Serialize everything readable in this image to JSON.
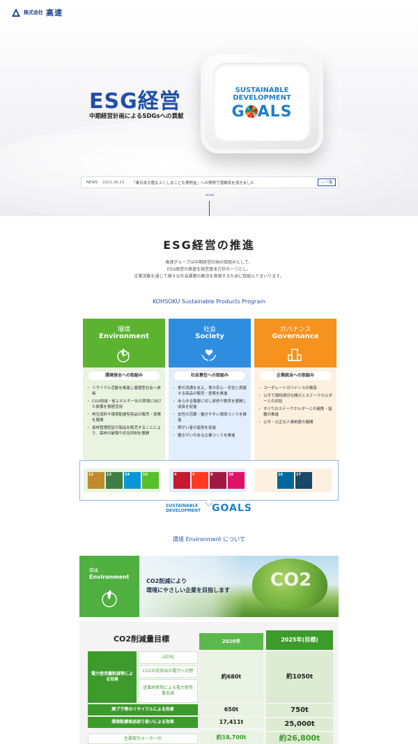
{
  "header": {
    "logo_prefix": "株式会社",
    "logo_name": "高速"
  },
  "hero": {
    "title": "ESG経営",
    "subtitle": "中期経営計画によるSDGsへの貢献",
    "sdg_logo_line1": "SUSTAINABLE",
    "sdg_logo_line2": "DEVELOPMENT",
    "sdg_logo_g": "G",
    "sdg_logo_als": "ALS"
  },
  "news": {
    "label": "NEWS",
    "date": "2021.06.23",
    "text": "「東日本大震災ふくしまこども寄附金」への寄附で感謝状を頂きました",
    "all_button": "一覧"
  },
  "scroll_label": "scroll",
  "section": {
    "title": "ESG経営の推進",
    "intro_lines": [
      "高速グループは中期経営計画の取組みとして、",
      "ESG経営の推進を経営基本方針の一つとし、",
      "企業活動を通じて様々な社会課題の解決を実現するために取組んでまいります。"
    ],
    "program": "KOHSOKU Sustainable Products Program"
  },
  "columns": [
    {
      "jp": "環境",
      "en": "Environment",
      "icon": "leaf-globe-icon",
      "pill": "環境保全への取組み",
      "items": [
        "リサイクル活動を推進し循環型社会へ参画",
        "CO2削減・省エネルギー化の実現に向けた設備を積極活用",
        "再生原料や環境配慮型商品の販売・提案を展開",
        "森林管理認証の製品を販売することにより、森林の破壊や劣化抑制を展開"
      ]
    },
    {
      "jp": "社会",
      "en": "Society",
      "icon": "hands-heart-icon",
      "pill": "社会責任への取組み",
      "items": [
        "食の流通を支え、食の安心・安全に貢献する商品の販売・提案を推進",
        "あらゆる階層に対し研修や教育を展開し成長を促進",
        "女性の活躍・働きやすい環境つくりを推進",
        "障がい者の雇用を促進",
        "働きがいのある企業つくりを推進"
      ]
    },
    {
      "jp": "ガバナンス",
      "en": "Governance",
      "icon": "building-icon",
      "pill": "企業統治への取組み",
      "items": [
        "コーポレートガバナンスの徹底",
        "公平で適時適切な開示とステークホルダーとの対話",
        "すべてのステークホルダーとの連携・協働の推進",
        "公平・公正な人事制度の展開"
      ]
    }
  ],
  "sdg_tiles": {
    "env": [
      {
        "n": "12",
        "color": "#bf8b2e"
      },
      {
        "n": "13",
        "color": "#3f7e44"
      },
      {
        "n": "14",
        "color": "#0a97d9"
      },
      {
        "n": "15",
        "color": "#56c02b"
      }
    ],
    "soc": [
      {
        "n": "4",
        "color": "#c5192d"
      },
      {
        "n": "5",
        "color": "#ff3a21"
      },
      {
        "n": "8",
        "color": "#a21942"
      },
      {
        "n": "10",
        "color": "#dd1367"
      }
    ],
    "gov": [
      {
        "n": "16",
        "color": "#00689d"
      },
      {
        "n": "17",
        "color": "#19486a"
      }
    ]
  },
  "sdg_small_logo": {
    "line1": "SUSTAINABLE",
    "line2": "DEVELOPMENT",
    "goals": "GOALS"
  },
  "about_title": "環境 Environment について",
  "banner": {
    "jp": "環境",
    "en": "Environment",
    "msg_line1": "CO2削減により",
    "msg_line2": "環境にやさしい企業を目指します",
    "cloud_text": "CO2"
  },
  "table": {
    "title": "CO2削減量目標",
    "col_2020": "2020年",
    "col_2025": "2025年(目標)",
    "row_power_label": "電力使用量削減等による効果",
    "sub_items": [
      "LED化",
      "CO2の低排出の電力へ切替",
      "送風材使用による電力使用量低減"
    ],
    "power_2020": "約680t",
    "power_2025": "約1050t",
    "recycle_label": "廃プラ等のリサイクルによる効果",
    "recycle_2020": "650t",
    "recycle_2025": "750t",
    "eco_label": "環境配慮商品取り扱いによる効果",
    "eco_2020": "17,411t",
    "eco_2025": "25,000t",
    "next_label": "主要取引メーカーの",
    "total_2020": "約18,700t",
    "total_2025": "約26,800t"
  }
}
